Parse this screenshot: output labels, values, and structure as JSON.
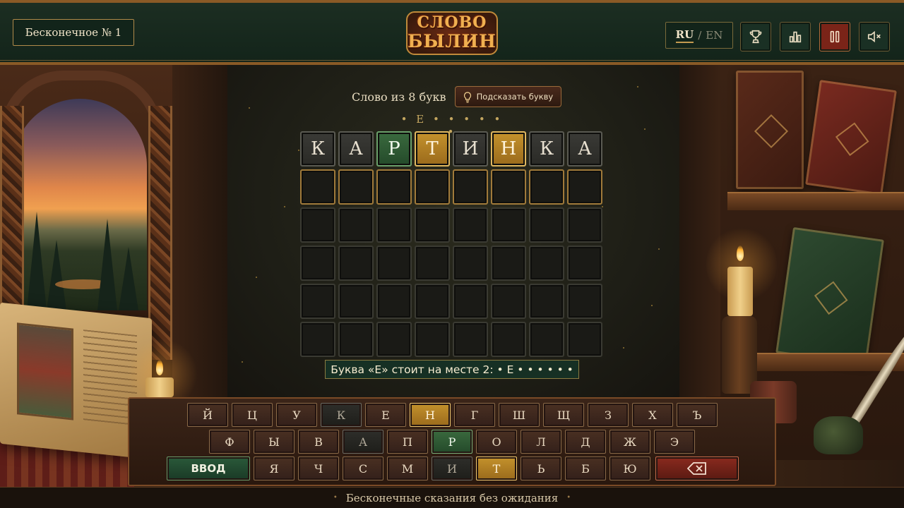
{
  "header": {
    "mode": "Бесконечное № 1",
    "logo_line1": "СЛОВО",
    "logo_line2": "БЫЛИН",
    "lang_active": "RU",
    "lang_separator": "/",
    "lang_inactive": "EN"
  },
  "board": {
    "word_length_label": "Слово из 8 букв",
    "hint_button": "Подсказать букву",
    "pattern": "• Е • • • • • •",
    "rows": [
      [
        {
          "letter": "К",
          "state": "absent"
        },
        {
          "letter": "А",
          "state": "absent"
        },
        {
          "letter": "Р",
          "state": "correct"
        },
        {
          "letter": "Т",
          "state": "present"
        },
        {
          "letter": "И",
          "state": "absent"
        },
        {
          "letter": "Н",
          "state": "present"
        },
        {
          "letter": "К",
          "state": "absent"
        },
        {
          "letter": "А",
          "state": "absent"
        }
      ],
      [
        {
          "letter": "",
          "state": "active"
        },
        {
          "letter": "",
          "state": "active"
        },
        {
          "letter": "",
          "state": "active"
        },
        {
          "letter": "",
          "state": "active"
        },
        {
          "letter": "",
          "state": "active"
        },
        {
          "letter": "",
          "state": "active"
        },
        {
          "letter": "",
          "state": "active"
        },
        {
          "letter": "",
          "state": "active"
        }
      ],
      [
        {
          "letter": "",
          "state": "empty"
        },
        {
          "letter": "",
          "state": "empty"
        },
        {
          "letter": "",
          "state": "empty"
        },
        {
          "letter": "",
          "state": "empty"
        },
        {
          "letter": "",
          "state": "empty"
        },
        {
          "letter": "",
          "state": "empty"
        },
        {
          "letter": "",
          "state": "empty"
        },
        {
          "letter": "",
          "state": "empty"
        }
      ],
      [
        {
          "letter": "",
          "state": "empty"
        },
        {
          "letter": "",
          "state": "empty"
        },
        {
          "letter": "",
          "state": "empty"
        },
        {
          "letter": "",
          "state": "empty"
        },
        {
          "letter": "",
          "state": "empty"
        },
        {
          "letter": "",
          "state": "empty"
        },
        {
          "letter": "",
          "state": "empty"
        },
        {
          "letter": "",
          "state": "empty"
        }
      ],
      [
        {
          "letter": "",
          "state": "empty"
        },
        {
          "letter": "",
          "state": "empty"
        },
        {
          "letter": "",
          "state": "empty"
        },
        {
          "letter": "",
          "state": "empty"
        },
        {
          "letter": "",
          "state": "empty"
        },
        {
          "letter": "",
          "state": "empty"
        },
        {
          "letter": "",
          "state": "empty"
        },
        {
          "letter": "",
          "state": "empty"
        }
      ],
      [
        {
          "letter": "",
          "state": "empty"
        },
        {
          "letter": "",
          "state": "empty"
        },
        {
          "letter": "",
          "state": "empty"
        },
        {
          "letter": "",
          "state": "empty"
        },
        {
          "letter": "",
          "state": "empty"
        },
        {
          "letter": "",
          "state": "empty"
        },
        {
          "letter": "",
          "state": "empty"
        },
        {
          "letter": "",
          "state": "empty"
        }
      ]
    ],
    "message": "Буква «Е» стоит на месте 2: • Е • • • • • •"
  },
  "keyboard": {
    "row1": [
      {
        "label": "Й",
        "state": ""
      },
      {
        "label": "Ц",
        "state": ""
      },
      {
        "label": "У",
        "state": ""
      },
      {
        "label": "К",
        "state": "absent"
      },
      {
        "label": "Е",
        "state": ""
      },
      {
        "label": "Н",
        "state": "present"
      },
      {
        "label": "Г",
        "state": ""
      },
      {
        "label": "Ш",
        "state": ""
      },
      {
        "label": "Щ",
        "state": ""
      },
      {
        "label": "З",
        "state": ""
      },
      {
        "label": "Х",
        "state": ""
      },
      {
        "label": "Ъ",
        "state": ""
      }
    ],
    "row2": [
      {
        "label": "Ф",
        "state": ""
      },
      {
        "label": "Ы",
        "state": ""
      },
      {
        "label": "В",
        "state": ""
      },
      {
        "label": "А",
        "state": "absent"
      },
      {
        "label": "П",
        "state": ""
      },
      {
        "label": "Р",
        "state": "correct"
      },
      {
        "label": "О",
        "state": ""
      },
      {
        "label": "Л",
        "state": ""
      },
      {
        "label": "Д",
        "state": ""
      },
      {
        "label": "Ж",
        "state": ""
      },
      {
        "label": "Э",
        "state": ""
      }
    ],
    "row3": [
      {
        "label": "Я",
        "state": ""
      },
      {
        "label": "Ч",
        "state": ""
      },
      {
        "label": "С",
        "state": ""
      },
      {
        "label": "М",
        "state": ""
      },
      {
        "label": "И",
        "state": "absent"
      },
      {
        "label": "Т",
        "state": "present"
      },
      {
        "label": "Ь",
        "state": ""
      },
      {
        "label": "Б",
        "state": ""
      },
      {
        "label": "Ю",
        "state": ""
      }
    ],
    "enter_label": "ВВОД",
    "backspace_icon": "backspace-icon"
  },
  "footer": {
    "tagline": "Бесконечные сказания без ожидания",
    "bullet": "•"
  },
  "icons": {
    "trophy": "trophy-icon",
    "stats": "stats-icon",
    "pause": "pause-icon",
    "mute": "sound-muted-icon",
    "hint": "lightbulb-icon"
  },
  "colors": {
    "correct": "#3a6a3e",
    "present": "#c4922c",
    "absent": "#3a3a36",
    "header_bg": "#1c2e22",
    "accent_gold": "#c49a50"
  }
}
